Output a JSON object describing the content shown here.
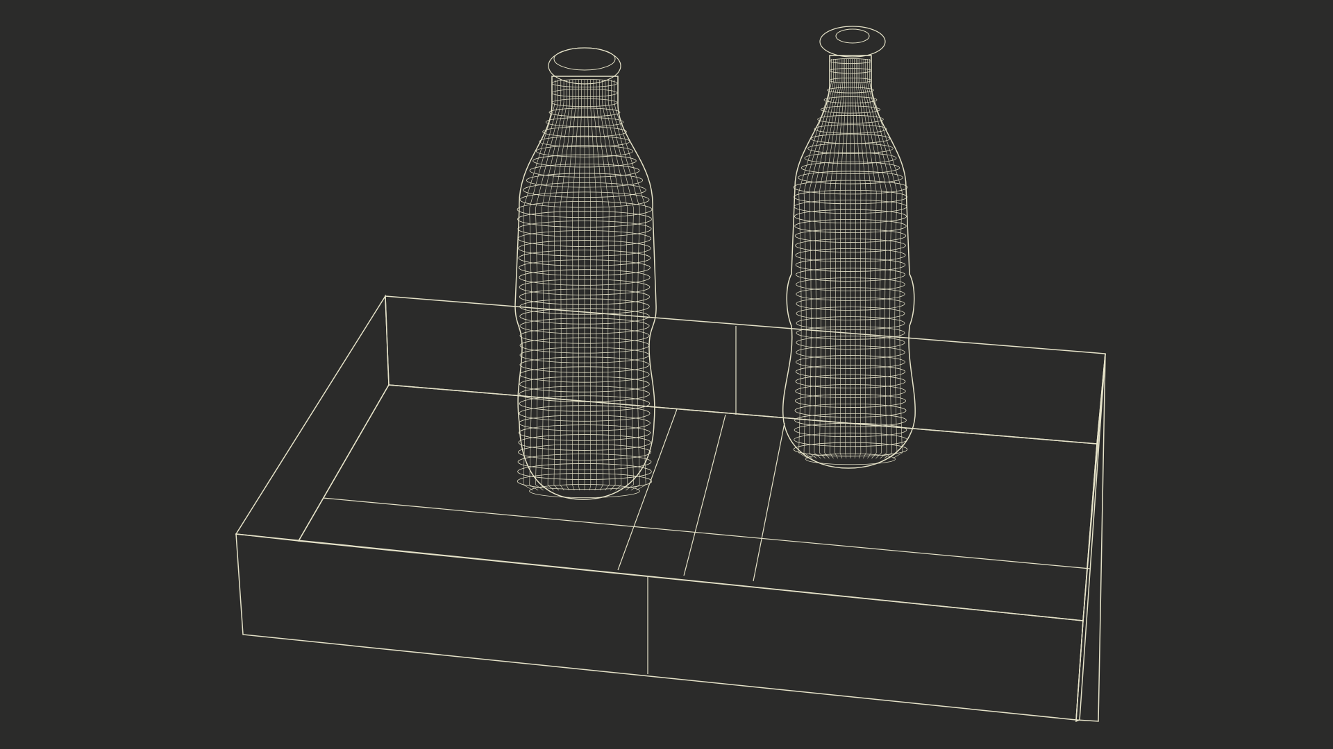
{
  "scene": {
    "kind": "wireframe-render",
    "objects": [
      "bottle-with-cap",
      "bottle-open",
      "tray"
    ]
  },
  "colors": {
    "background": "#2b2b2a",
    "wire": "#e6e3c9",
    "tray_floor": "#5f6057",
    "tray_wall_outer": "#7a7b6f",
    "bottle_fill": "#74756b"
  }
}
